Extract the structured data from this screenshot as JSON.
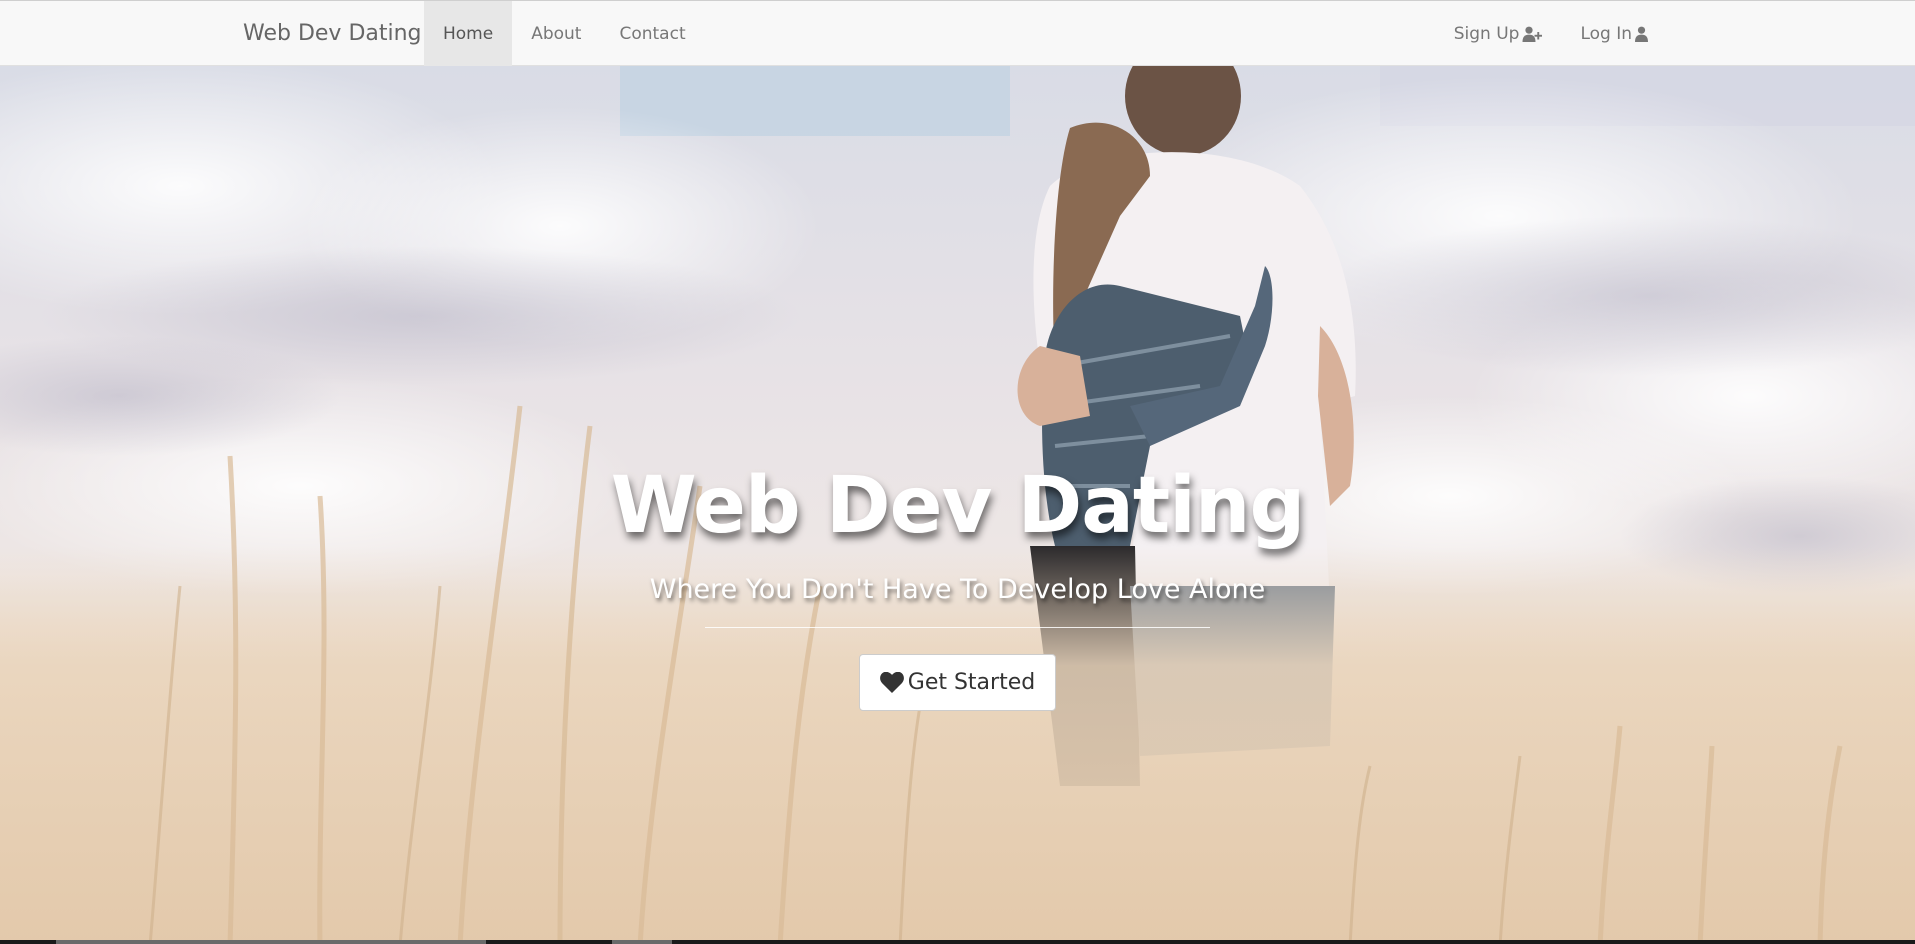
{
  "navbar": {
    "brand": "Web Dev Dating",
    "left_items": [
      {
        "label": "Home",
        "active": true
      },
      {
        "label": "About",
        "active": false
      },
      {
        "label": "Contact",
        "active": false
      }
    ],
    "right_items": [
      {
        "label": "Sign Up",
        "icon": "user-plus-icon"
      },
      {
        "label": "Log In",
        "icon": "user-icon"
      }
    ]
  },
  "hero": {
    "title": "Web Dev Dating",
    "subtitle": "Where You Don't Have To Develop Love Alone",
    "cta_label": "Get Started",
    "cta_icon": "heart-icon",
    "background": "couple-embracing-in-field-photo"
  },
  "colors": {
    "navbar_bg": "#f8f8f8",
    "active_tab_bg": "#e7e7e7",
    "nav_text": "#777777",
    "hero_text": "#ffffff",
    "button_bg": "#ffffff"
  }
}
